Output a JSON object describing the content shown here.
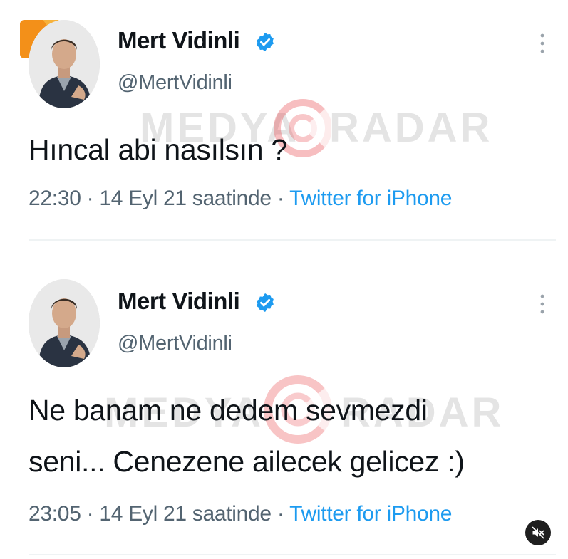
{
  "tweets": [
    {
      "display_name": "Mert Vidinli",
      "handle": "@MertVidinli",
      "text": "Hıncal abi nasılsın ?",
      "time": "22:30",
      "date": "14 Eyl 21 saatinde",
      "source": "Twitter for iPhone"
    },
    {
      "display_name": "Mert Vidinli",
      "handle": "@MertVidinli",
      "text_line1": "Ne banam ne dedem sevmezdi",
      "text_line2": "seni... Cenezene ailecek gelicez :)",
      "time": "23:05",
      "date": "14 Eyl 21 saatinde",
      "source": "Twitter for iPhone"
    }
  ],
  "separator": "·",
  "watermark": {
    "left": "MEDYA",
    "right": "RADAR"
  },
  "icons": {
    "verified": "verified-badge-icon",
    "more": "more-options-icon",
    "mute": "speaker-muted-icon",
    "corner_logo": "app-logo-icon"
  },
  "colors": {
    "text": "#0f1419",
    "secondary": "#536471",
    "link": "#1d9bf0",
    "verified": "#1d9bf0",
    "divider": "#eff3f4",
    "watermark_accent": "#e8464b",
    "logo": "#f39019"
  }
}
